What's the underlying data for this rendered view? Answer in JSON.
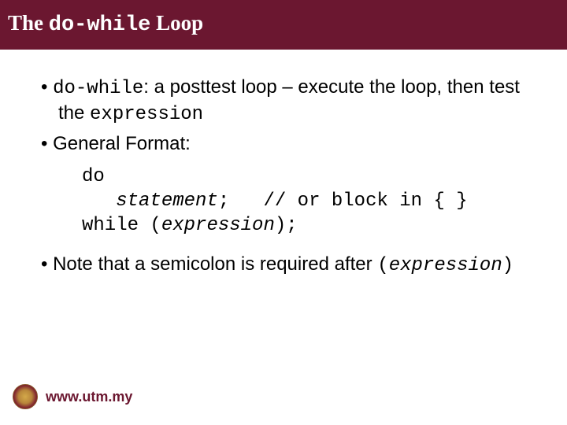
{
  "title": {
    "part1": "The ",
    "code": "do-while",
    "part2": " Loop"
  },
  "bullet1": {
    "code1": "do-while",
    "text1": ": a posttest loop – execute the loop, then test the ",
    "code2": "expression"
  },
  "bullet2": {
    "text": "General Format:"
  },
  "code": {
    "line1": "do",
    "line2_a": "   ",
    "line2_stmt": "statement",
    "line2_b": ";   // or block in { }",
    "line3_a": "while (",
    "line3_expr": "expression",
    "line3_b": ");"
  },
  "bullet3": {
    "text1": "Note that a semicolon is required after ",
    "code_open": "(",
    "code_expr": "expression",
    "code_close": ")"
  },
  "footer": {
    "url": "www.utm.my"
  }
}
